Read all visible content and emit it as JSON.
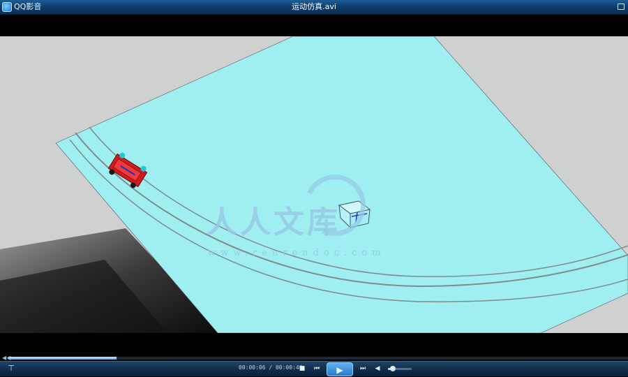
{
  "titlebar": {
    "app_name": "QQ影音",
    "window_title": "运动仿真.avi",
    "icons": [
      "app-logo-icon",
      "restore-icon"
    ]
  },
  "video": {
    "watermark_text": "人人文库",
    "watermark_url": "www.renrendoc.com",
    "colors": {
      "floor": "#a0eff0",
      "background": "#cfd0d0",
      "track_line": "#808888",
      "car": "#d21b1b",
      "cube": "#b8f4f8"
    }
  },
  "playback": {
    "time_display": "00:00:06 / 00:00:40",
    "progress": 0.175,
    "volume": 0.2
  },
  "controls": {
    "stop": "■",
    "prev": "⏮",
    "play": "▶",
    "next": "⏭",
    "volume": "◀",
    "pin": "⊤",
    "seek_back": "◀◀"
  }
}
